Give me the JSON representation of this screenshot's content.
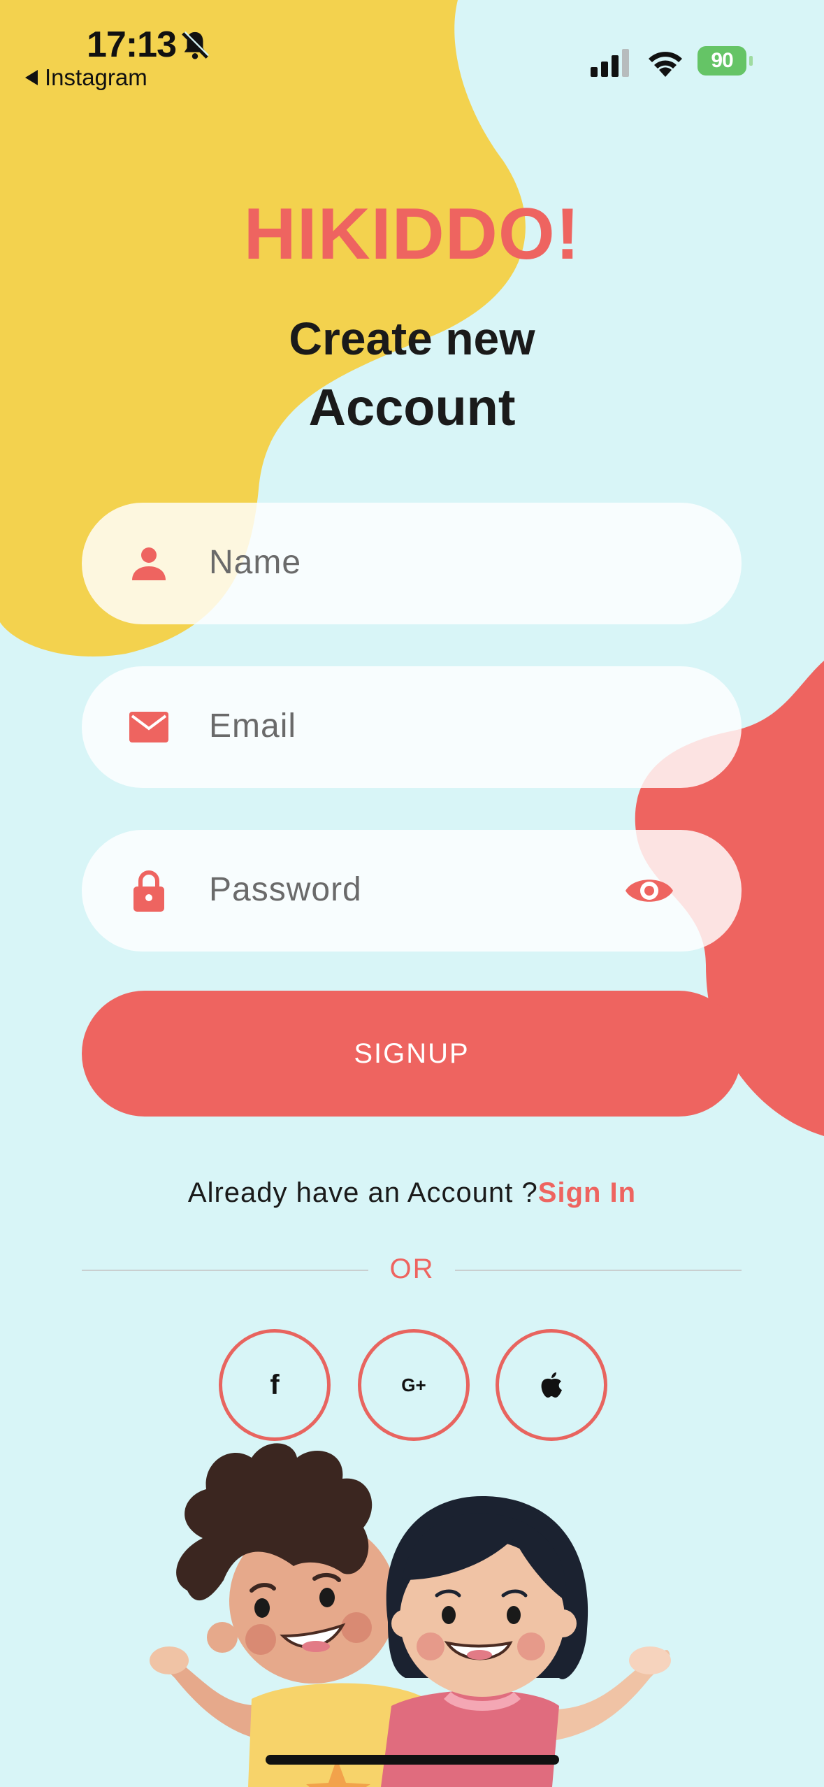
{
  "status_bar": {
    "time": "17:13",
    "back_app": "Instagram",
    "battery": "90",
    "icons": [
      "bell-slash-icon",
      "signal-icon",
      "wifi-icon",
      "battery-charging-icon"
    ]
  },
  "brand": "HIKIDDO!",
  "heading": {
    "line1": "Create new",
    "line2": "Account"
  },
  "form": {
    "name_placeholder": "Name",
    "email_placeholder": "Email",
    "password_placeholder": "Password",
    "name_icon": "person-icon",
    "email_icon": "envelope-icon",
    "password_icon": "lock-icon",
    "reveal_icon": "eye-icon"
  },
  "signup_label": "SIGNUP",
  "signin_prompt": {
    "text": "Already have an Account ?",
    "link": "Sign In"
  },
  "divider_label": "OR",
  "social": [
    {
      "label": "f",
      "icon": "facebook-icon"
    },
    {
      "label": "G+",
      "icon": "google-plus-icon"
    },
    {
      "label": "",
      "icon": "apple-icon"
    }
  ],
  "colors": {
    "background": "#d8f5f7",
    "accent": "#ee6460",
    "yellow_blob": "#f3d24e",
    "field_bg": "#fafefe"
  }
}
